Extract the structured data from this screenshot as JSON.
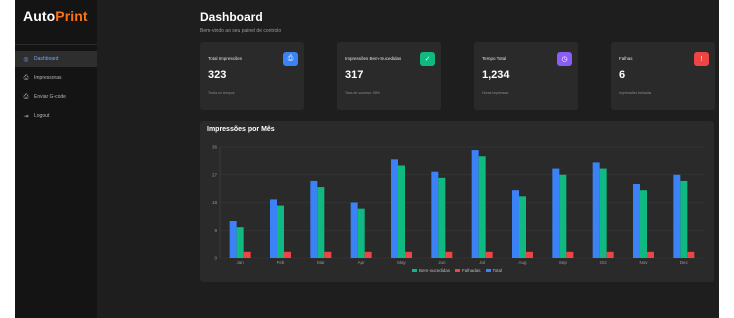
{
  "sidebar": {
    "logo_part1": "Auto",
    "logo_part2": "Print",
    "items": [
      {
        "label": "Dashboard",
        "icon": "dashboard-icon",
        "active": true
      },
      {
        "label": "Impressoras",
        "icon": "printer-icon",
        "active": false
      },
      {
        "label": "Enviar G-code",
        "icon": "upload-icon",
        "active": false
      },
      {
        "label": "Logout",
        "icon": "logout-icon",
        "active": false
      }
    ]
  },
  "header": {
    "title": "Dashboard",
    "subtitle": "Bem-vindo ao seu painel de controlo"
  },
  "cards": [
    {
      "label": "Total Impressões",
      "value": "323",
      "sub": "Todos os tempos",
      "icon": "printer-icon",
      "color": "#3b82f6"
    },
    {
      "label": "Impressões Bem-Sucedidas",
      "value": "317",
      "sub": "Taxa de sucesso: 98%",
      "icon": "check-icon",
      "color": "#10b981"
    },
    {
      "label": "Tempo Total",
      "value": "1,234",
      "sub": "Horas impressas",
      "icon": "clock-icon",
      "color": "#8b5cf6"
    },
    {
      "label": "Falhas",
      "value": "6",
      "sub": "Impressões falhadas",
      "icon": "alert-icon",
      "color": "#ef4444"
    }
  ],
  "chart_data": {
    "type": "bar",
    "title": "Impressões por Mês",
    "categories": [
      "Jan",
      "Feb",
      "Mar",
      "Apr",
      "May",
      "Jun",
      "Jul",
      "Aug",
      "Sep",
      "Oct",
      "Nov",
      "Dec"
    ],
    "yticks": [
      0,
      9,
      18,
      27,
      36
    ],
    "ylim": [
      0,
      36
    ],
    "grid": true,
    "legend_position": "bottom",
    "series": [
      {
        "name": "Bem-sucedidas",
        "color": "#10b981",
        "values": [
          10,
          17,
          23,
          16,
          30,
          26,
          33,
          20,
          27,
          29,
          22,
          25
        ]
      },
      {
        "name": "Falhadas",
        "color": "#ef4444",
        "values": [
          2,
          2,
          2,
          2,
          2,
          2,
          2,
          2,
          2,
          2,
          2,
          2
        ]
      },
      {
        "name": "Total",
        "color": "#3b82f6",
        "values": [
          12,
          19,
          25,
          18,
          32,
          28,
          35,
          22,
          29,
          31,
          24,
          27
        ]
      }
    ],
    "draw_order": [
      2,
      0,
      1
    ]
  }
}
